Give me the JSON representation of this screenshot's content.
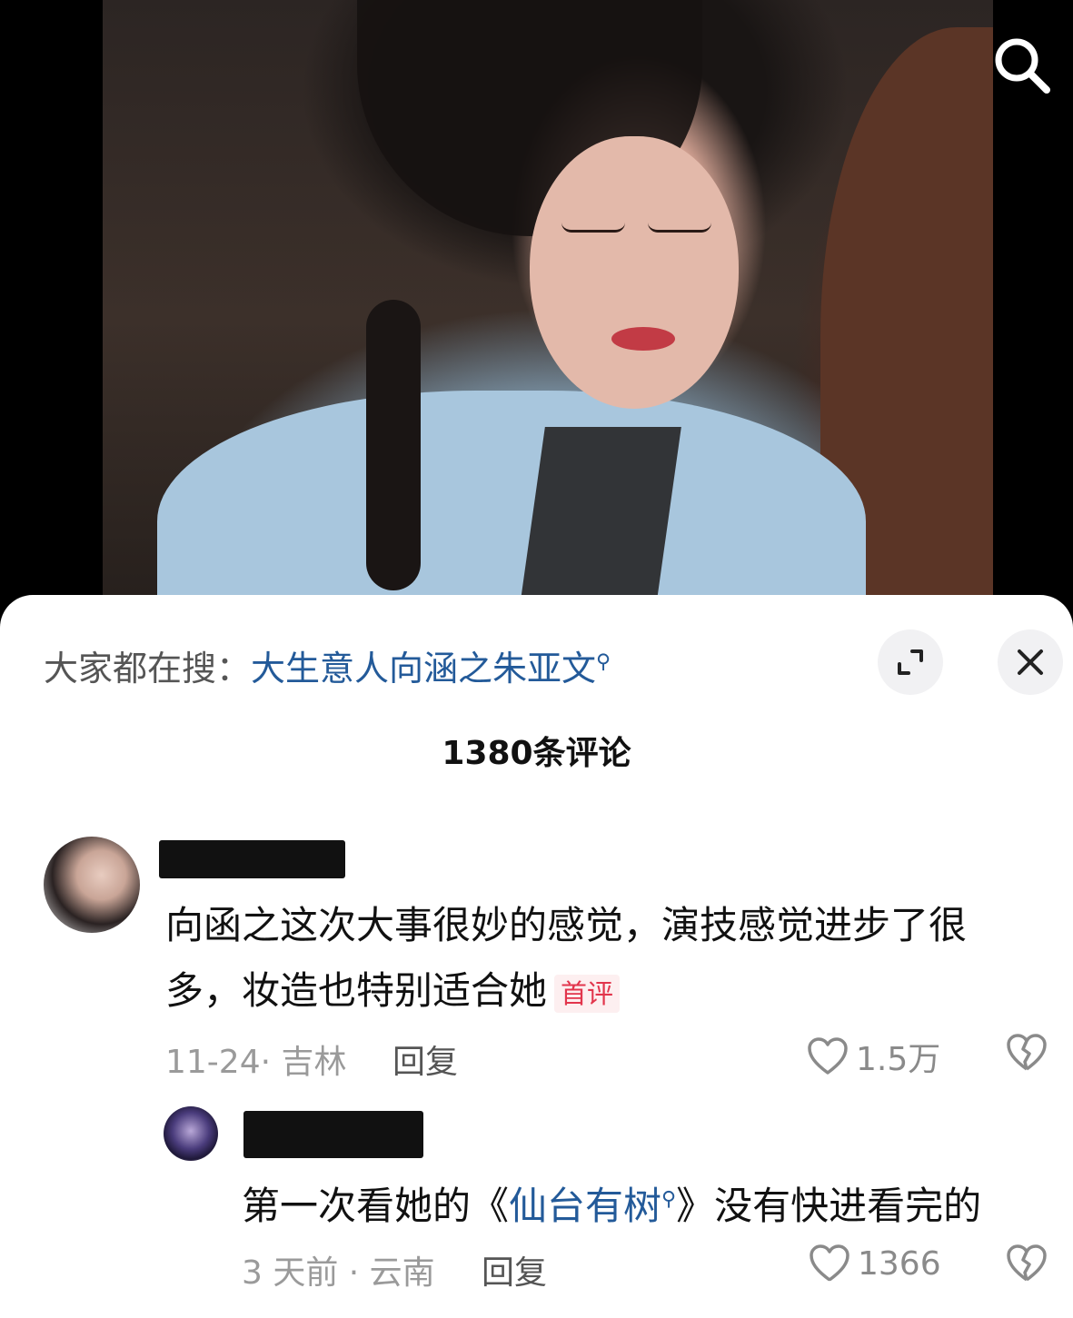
{
  "trending": {
    "prefix": "大家都在搜：",
    "query": "大生意人向涵之朱亚文"
  },
  "comments_count_label": "1380条评论",
  "comments": [
    {
      "text_line1": "向函之这次大事很妙的感觉，演技感觉进步了很",
      "text_line2": "多，妆造也特别适合她",
      "badge": "首评",
      "date_location": "11-24· 吉林",
      "reply_label": "回复",
      "likes": "1.5万"
    },
    {
      "text_prefix": "第一次看她的《",
      "text_link": "仙台有树",
      "text_suffix": "》没有快进看完的",
      "date_location": "3 天前 · 云南",
      "reply_label": "回复",
      "likes": "1366"
    }
  ],
  "icons": {
    "search": "search-icon",
    "expand": "expand-icon",
    "close": "close-icon",
    "like": "heart-icon",
    "dislike": "broken-heart-icon"
  }
}
